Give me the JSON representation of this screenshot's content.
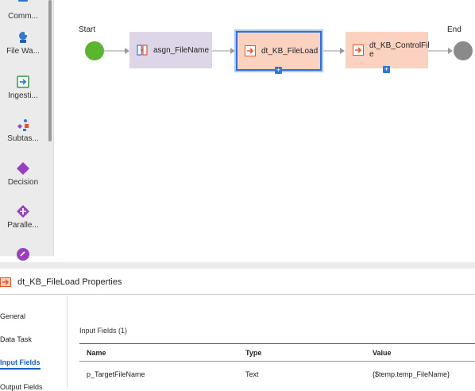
{
  "palette": {
    "items": [
      {
        "label": "Comm...",
        "icon": "command-icon"
      },
      {
        "label": "File Wa...",
        "icon": "file-watch-icon"
      },
      {
        "label": "Ingesti...",
        "icon": "ingestion-icon"
      },
      {
        "label": "Subtas...",
        "icon": "subtask-icon"
      },
      {
        "label": "Decision",
        "icon": "decision-icon"
      },
      {
        "label": "Paralle...",
        "icon": "parallel-paths-icon"
      }
    ]
  },
  "flow": {
    "start_label": "Start",
    "end_label": "End",
    "steps": [
      {
        "label": "asgn_FileName",
        "icon": "assignment-icon"
      },
      {
        "label": "dt_KB_FileLoad",
        "icon": "data-task-icon"
      },
      {
        "label": "dt_KB_ControlFil\ne",
        "icon": "data-task-icon"
      }
    ]
  },
  "properties": {
    "title": "dt_KB_FileLoad Properties",
    "tabs": [
      "General",
      "Data Task",
      "Input Fields",
      "Output Fields"
    ],
    "active_tab": "Input Fields",
    "section_title": "Input Fields (1)",
    "columns": [
      "Name",
      "Type",
      "Value"
    ],
    "rows": [
      {
        "name": "p_TargetFileName",
        "type": "Text",
        "value": "{$temp.temp_FileName}"
      }
    ]
  },
  "colors": {
    "accent": "#1a5fc7",
    "start_node": "#5cb52f",
    "end_node": "#888888",
    "assignment_fill": "#ddd5e8",
    "data_task_fill": "#fbd2c0",
    "selection_border": "#2f6fd6"
  }
}
